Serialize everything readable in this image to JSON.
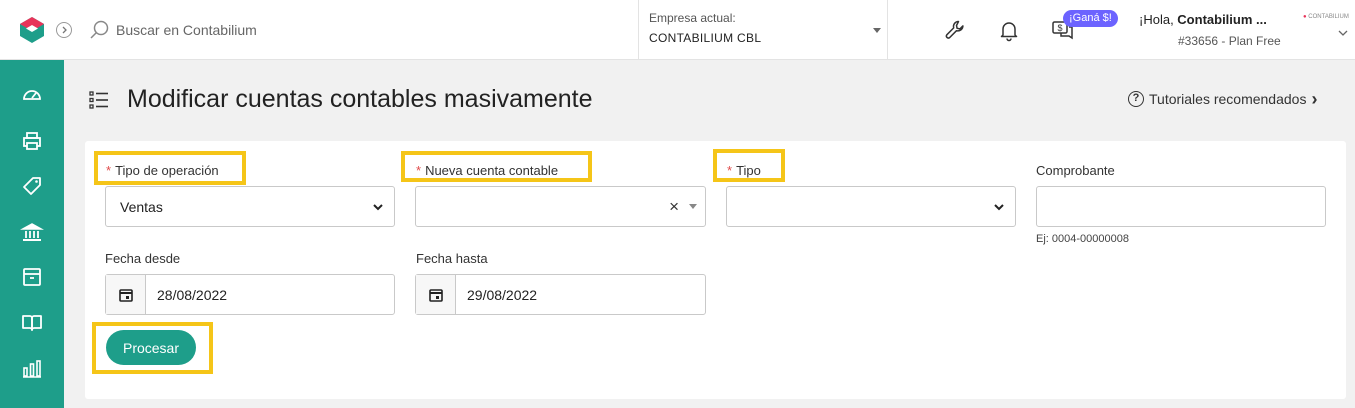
{
  "header": {
    "search_placeholder": "Buscar en Contabilium",
    "company_label": "Empresa actual:",
    "company_name": "CONTABILIUM CBL",
    "badge": "¡Ganá $!",
    "greeting_prefix": "¡Hola, ",
    "user_name": "Contabilium ...",
    "account_info": "#33656 - Plan Free",
    "mini_brand": "CONTABILIUM"
  },
  "sidebar": {
    "items": [
      "dashboard-icon",
      "printer-icon",
      "tag-icon",
      "bank-icon",
      "box-icon",
      "book-icon",
      "chart-icon"
    ]
  },
  "page": {
    "title": "Modificar cuentas contables masivamente",
    "tutorials": "Tutoriales recomendados",
    "help_glyph": "?",
    "chevron_glyph": "›"
  },
  "form": {
    "required_mark": "*",
    "tipo_operacion": {
      "label": "Tipo de operación",
      "value": "Ventas"
    },
    "nueva_cuenta": {
      "label": "Nueva cuenta contable",
      "value": "",
      "clear": "×"
    },
    "tipo": {
      "label": "Tipo",
      "value": ""
    },
    "comprobante": {
      "label": "Comprobante",
      "value": "",
      "hint": "Ej: 0004-00000008"
    },
    "fecha_desde": {
      "label": "Fecha desde",
      "value": "28/08/2022"
    },
    "fecha_hasta": {
      "label": "Fecha hasta",
      "value": "29/08/2022"
    },
    "submit": "Procesar"
  },
  "colors": {
    "brand": "#1e9e8a",
    "highlight": "#f5c518",
    "required": "#e04b4b",
    "badge": "#6c63ff"
  }
}
